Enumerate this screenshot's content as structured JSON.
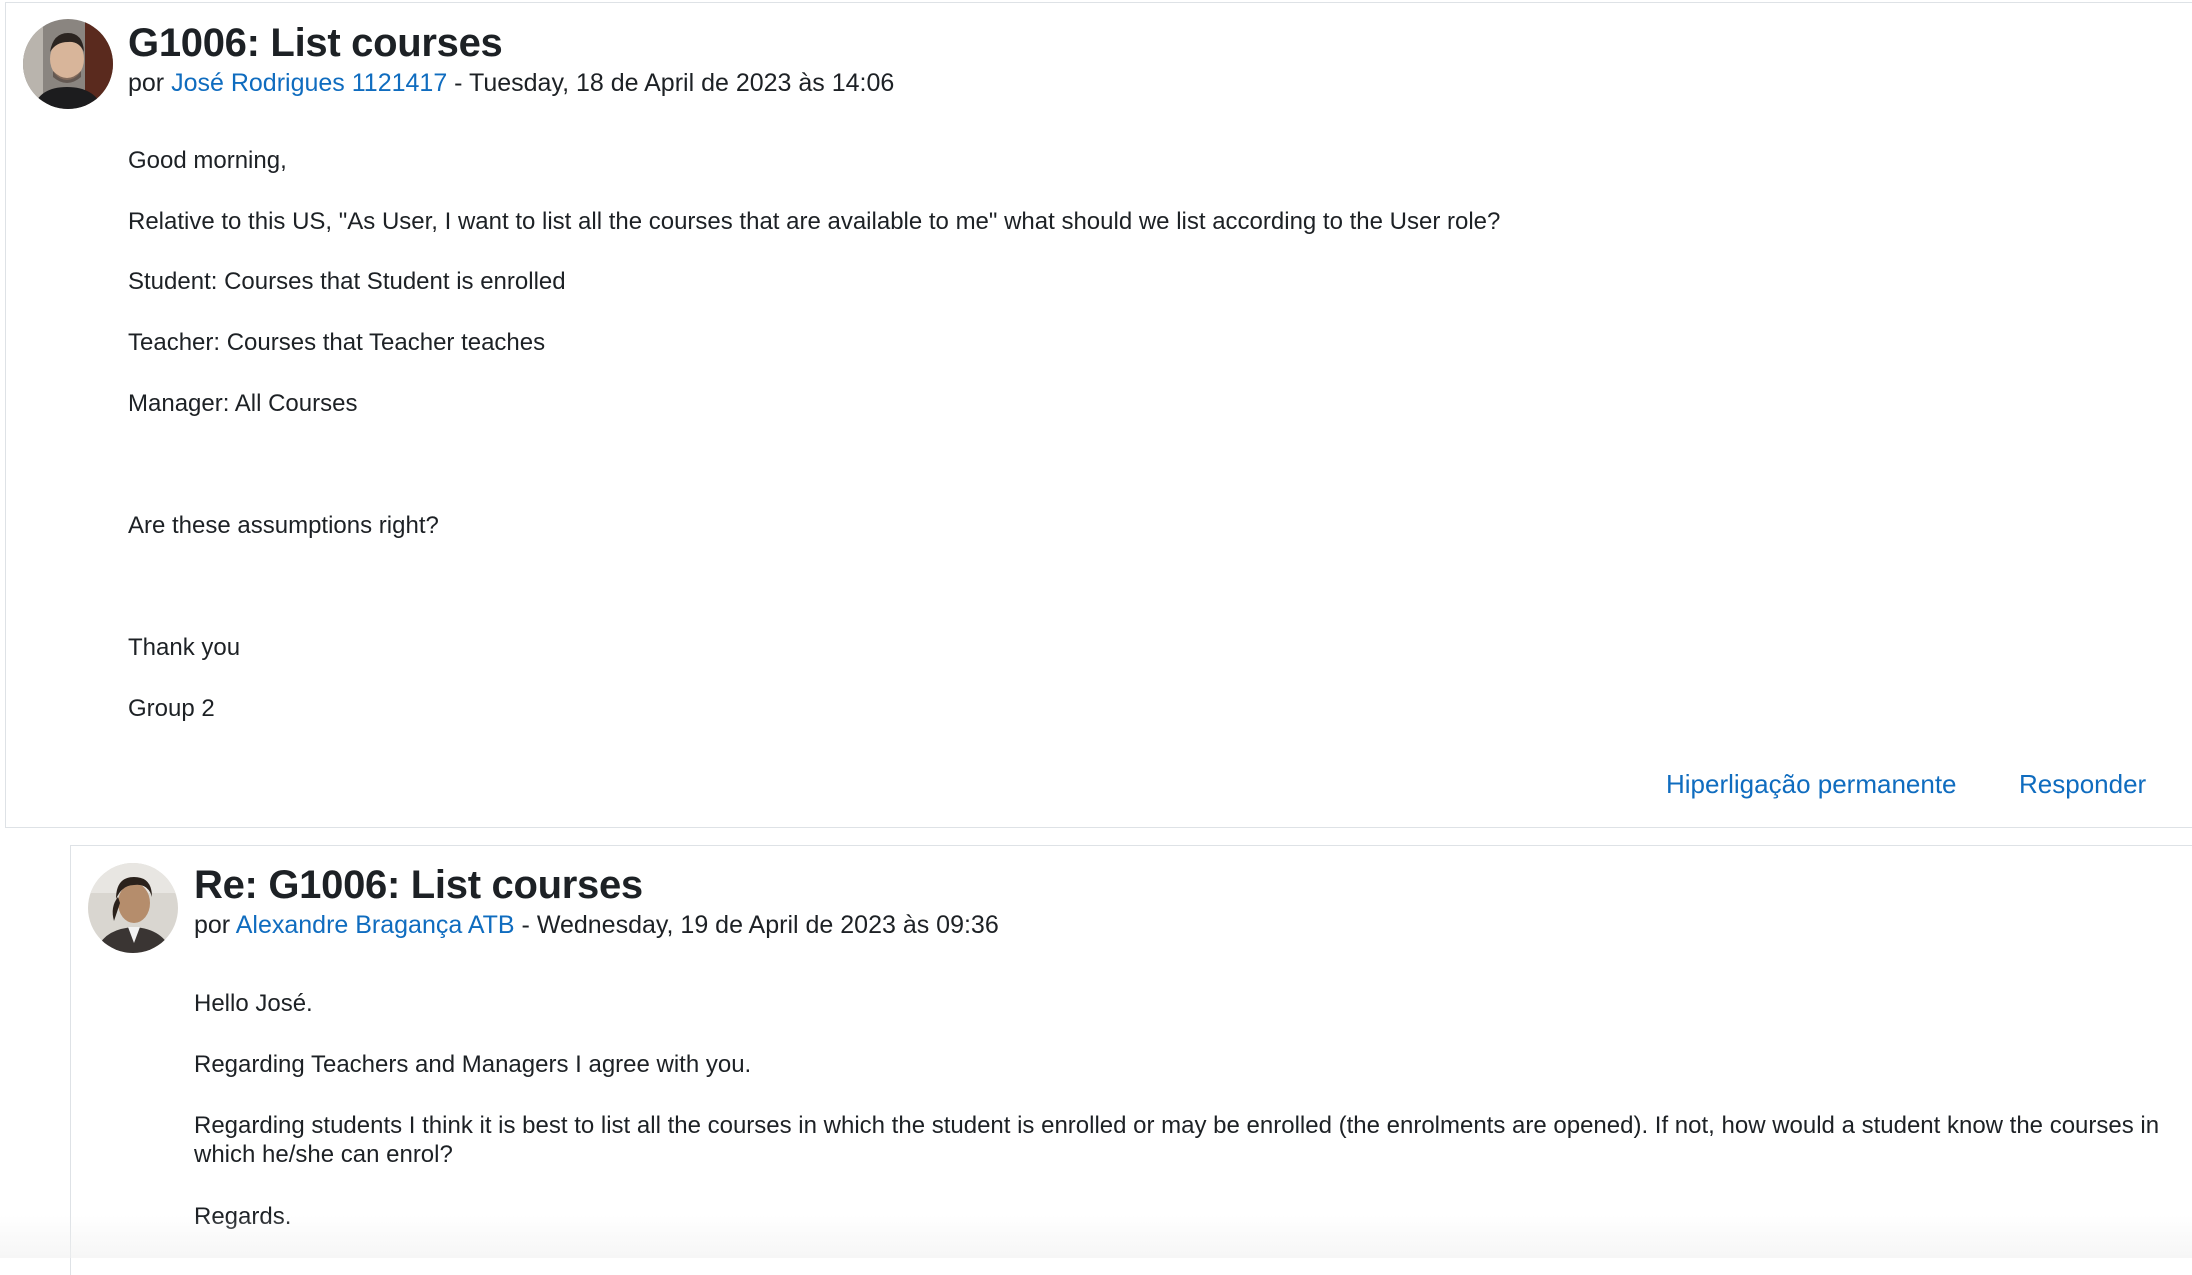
{
  "posts": [
    {
      "title": "G1006: List courses",
      "by_prefix": "por",
      "author": "José Rodrigues 1121417",
      "date_suffix": "- Tuesday, 18 de April de 2023 às 14:06",
      "paragraphs": [
        "Good morning,",
        "Relative to this US, \"As User, I want to list all the courses that are available to me\" what should we list according to the User role?",
        "Student: Courses that Student is enrolled",
        "Teacher: Courses that Teacher teaches",
        "Manager: All Courses",
        "Are these assumptions right?",
        "Thank you",
        "Group 2"
      ],
      "actions": {
        "permalink": "Hiperligação permanente",
        "reply": "Responder"
      }
    },
    {
      "title": "Re: G1006: List courses",
      "by_prefix": "por",
      "author": "Alexandre Bragança ATB",
      "date_suffix": "- Wednesday, 19 de April de 2023 às 09:36",
      "paragraphs": [
        "Hello José.",
        "Regarding Teachers and Managers I agree with you.",
        "Regarding students I think it is best to list all the courses in which the student is enrolled or may be enrolled (the enrolments are opened). If not, how would a student know the courses in which he/she can enrol?",
        "Regards."
      ]
    }
  ],
  "colors": {
    "link": "#0f6cbf",
    "text": "#1d2125",
    "border": "#dee2e6"
  },
  "icons": {
    "author_avatar_1": "user-photo-avatar",
    "author_avatar_2": "user-photo-avatar"
  }
}
